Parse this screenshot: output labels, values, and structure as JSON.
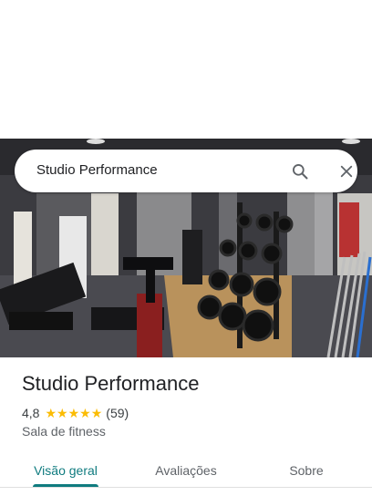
{
  "search": {
    "query": "Studio Performance"
  },
  "photo": {
    "description_icon": "gym-photo"
  },
  "place": {
    "name": "Studio Performance",
    "rating": "4,8",
    "stars_filled": 5,
    "review_count": "(59)",
    "category": "Sala de fitness"
  },
  "tabs": [
    {
      "label": "Visão geral",
      "active": true
    },
    {
      "label": "Avaliações",
      "active": false
    },
    {
      "label": "Sobre",
      "active": false
    }
  ],
  "colors": {
    "accent": "#0f7b7f",
    "star": "#fbbc04"
  }
}
